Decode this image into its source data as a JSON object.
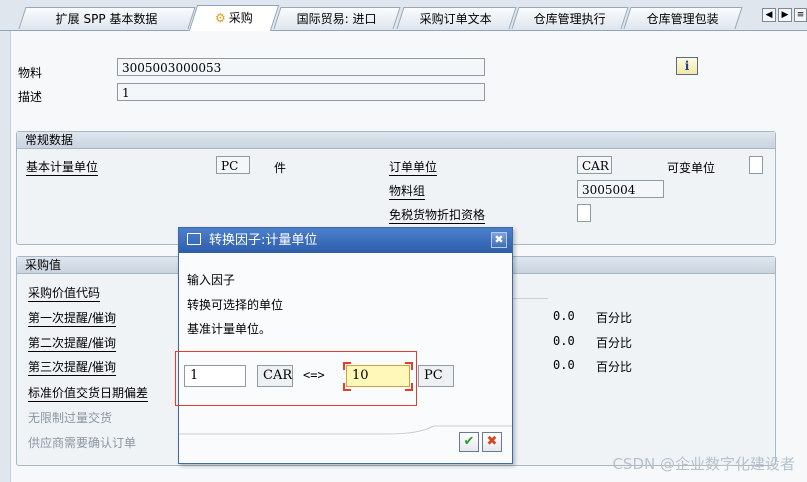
{
  "tabs": [
    {
      "label": "扩展 SPP 基本数据"
    },
    {
      "label": "采购"
    },
    {
      "label": "国际贸易: 进口"
    },
    {
      "label": "采购订单文本"
    },
    {
      "label": "仓库管理执行"
    },
    {
      "label": "仓库管理包装"
    }
  ],
  "header": {
    "material_label": "物料",
    "material_value": "3005003000053",
    "desc_label": "描述",
    "desc_value": "1",
    "info_icon": "i"
  },
  "general": {
    "title": "常规数据",
    "base_uom_label": "基本计量单位",
    "base_uom_value": "PC",
    "base_uom_text": "件",
    "order_unit_label": "订单单位",
    "order_unit_value": "CAR",
    "var_unit_label": "可变单位",
    "mat_group_label": "物料组",
    "mat_group_value": "3005004",
    "tax_label": "免税货物折扣资格"
  },
  "purchasing": {
    "title": "采购值",
    "rows": [
      {
        "label": "采购价值代码"
      },
      {
        "label": "第一次提醒/催询",
        "value": "0.0",
        "unit": "百分比"
      },
      {
        "label": "第二次提醒/催询",
        "value": "0.0",
        "unit": "百分比"
      },
      {
        "label": "第三次提醒/催询",
        "value": "0.0",
        "unit": "百分比"
      },
      {
        "label": "标准价值交货日期偏差"
      },
      {
        "label": "无限制过量交货"
      },
      {
        "label": "供应商需要确认订单"
      }
    ]
  },
  "dialog": {
    "title": "转换因子:计量单位",
    "line1": "输入因子",
    "line2": "转换可选择的单位",
    "line3": "基准计量单位。",
    "left_value": "1",
    "left_unit": "CAR",
    "arrow": "<=>",
    "right_value": "10",
    "right_unit": "PC",
    "ok_symbol": "✔",
    "cancel_symbol": "✖",
    "close_symbol": "✖"
  },
  "watermark": "CSDN @企业数字化建设者",
  "colors": {
    "accent": "#2e5eaa",
    "highlight": "#e53c2c"
  }
}
